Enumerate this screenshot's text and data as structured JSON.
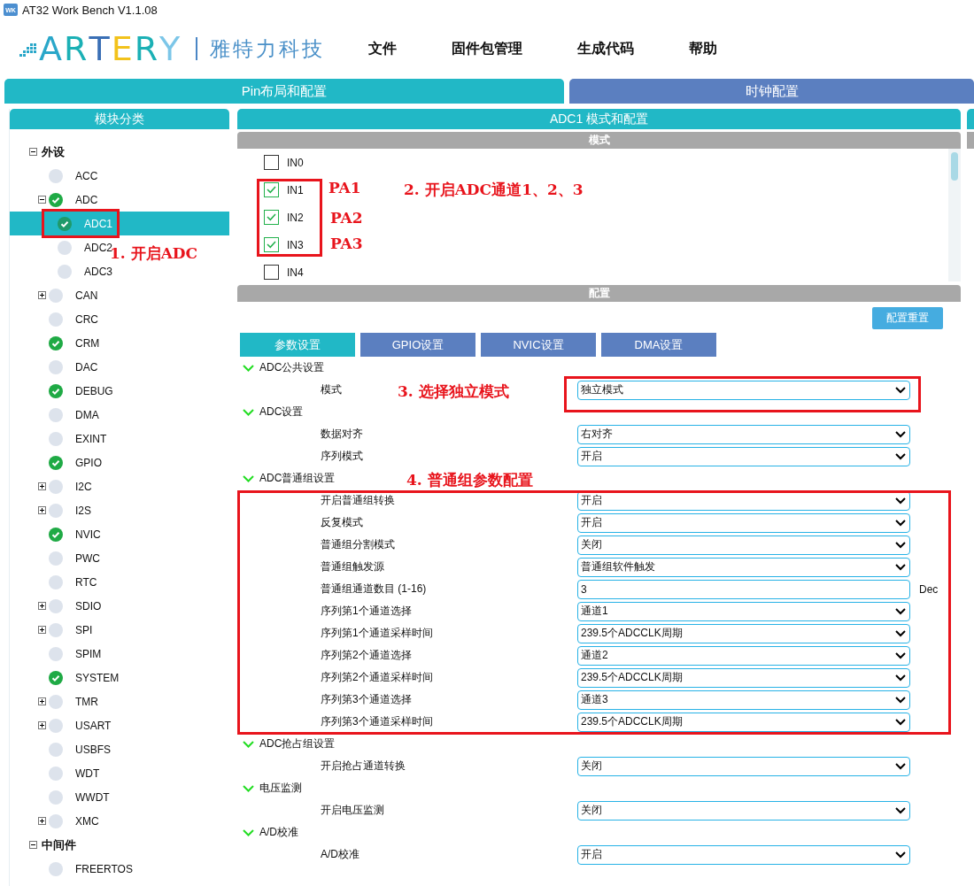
{
  "window": {
    "app_badge": "WK",
    "title": "AT32 Work Bench V1.1.08"
  },
  "header": {
    "logo_letters": [
      "A",
      "R",
      "T",
      "E",
      "R",
      "Y"
    ],
    "company": "雅特力科技",
    "menu": [
      "文件",
      "固件包管理",
      "生成代码",
      "帮助"
    ]
  },
  "top_tabs": [
    {
      "label": "Pin布局和配置",
      "selected": true
    },
    {
      "label": "时钟配置",
      "selected": false
    }
  ],
  "module_panel": {
    "title": "模块分类",
    "tree": [
      {
        "kind": "category",
        "label": "外设",
        "expanded": true,
        "children": [
          {
            "kind": "module",
            "label": "ACC",
            "checked": false,
            "selected": false
          },
          {
            "kind": "module",
            "label": "ADC",
            "checked": true,
            "selected": false,
            "expanded": true,
            "children": [
              {
                "kind": "module",
                "label": "ADC1",
                "checked": true,
                "selected": true
              },
              {
                "kind": "module",
                "label": "ADC2",
                "checked": false,
                "selected": false
              },
              {
                "kind": "module",
                "label": "ADC3",
                "checked": false,
                "selected": false
              }
            ]
          },
          {
            "kind": "module",
            "label": "CAN",
            "checked": false,
            "selected": false,
            "expanded": false
          },
          {
            "kind": "module",
            "label": "CRC",
            "checked": false,
            "selected": false
          },
          {
            "kind": "module",
            "label": "CRM",
            "checked": true,
            "selected": false
          },
          {
            "kind": "module",
            "label": "DAC",
            "checked": false,
            "selected": false
          },
          {
            "kind": "module",
            "label": "DEBUG",
            "checked": true,
            "selected": false
          },
          {
            "kind": "module",
            "label": "DMA",
            "checked": false,
            "selected": false
          },
          {
            "kind": "module",
            "label": "EXINT",
            "checked": false,
            "selected": false
          },
          {
            "kind": "module",
            "label": "GPIO",
            "checked": true,
            "selected": false
          },
          {
            "kind": "module",
            "label": "I2C",
            "checked": false,
            "selected": false,
            "expanded": false
          },
          {
            "kind": "module",
            "label": "I2S",
            "checked": false,
            "selected": false,
            "expanded": false
          },
          {
            "kind": "module",
            "label": "NVIC",
            "checked": true,
            "selected": false
          },
          {
            "kind": "module",
            "label": "PWC",
            "checked": false,
            "selected": false
          },
          {
            "kind": "module",
            "label": "RTC",
            "checked": false,
            "selected": false
          },
          {
            "kind": "module",
            "label": "SDIO",
            "checked": false,
            "selected": false,
            "expanded": false
          },
          {
            "kind": "module",
            "label": "SPI",
            "checked": false,
            "selected": false,
            "expanded": false
          },
          {
            "kind": "module",
            "label": "SPIM",
            "checked": false,
            "selected": false
          },
          {
            "kind": "module",
            "label": "SYSTEM",
            "checked": true,
            "selected": false
          },
          {
            "kind": "module",
            "label": "TMR",
            "checked": false,
            "selected": false,
            "expanded": false
          },
          {
            "kind": "module",
            "label": "USART",
            "checked": false,
            "selected": false,
            "expanded": false
          },
          {
            "kind": "module",
            "label": "USBFS",
            "checked": false,
            "selected": false
          },
          {
            "kind": "module",
            "label": "WDT",
            "checked": false,
            "selected": false
          },
          {
            "kind": "module",
            "label": "WWDT",
            "checked": false,
            "selected": false
          },
          {
            "kind": "module",
            "label": "XMC",
            "checked": false,
            "selected": false,
            "expanded": false
          }
        ]
      },
      {
        "kind": "category",
        "label": "中间件",
        "expanded": true,
        "children": [
          {
            "kind": "module",
            "label": "FREERTOS",
            "checked": false,
            "selected": false
          }
        ]
      }
    ]
  },
  "config_panel": {
    "title": "ADC1 模式和配置",
    "mode_title": "模式",
    "channels": [
      {
        "label": "IN0",
        "checked": false
      },
      {
        "label": "IN1",
        "checked": true
      },
      {
        "label": "IN2",
        "checked": true
      },
      {
        "label": "IN3",
        "checked": true
      },
      {
        "label": "IN4",
        "checked": false
      }
    ],
    "config_title": "配置",
    "reset_button": "配置重置",
    "tabs": [
      {
        "label": "参数设置",
        "selected": true
      },
      {
        "label": "GPIO设置",
        "selected": false
      },
      {
        "label": "NVIC设置",
        "selected": false
      },
      {
        "label": "DMA设置",
        "selected": false
      }
    ],
    "sections": [
      {
        "title": "ADC公共设置",
        "rows": [
          {
            "kind": "select",
            "label": "模式",
            "value": "独立模式"
          }
        ]
      },
      {
        "title": "ADC设置",
        "rows": [
          {
            "kind": "select",
            "label": "数据对齐",
            "value": "右对齐"
          },
          {
            "kind": "select",
            "label": "序列模式",
            "value": "开启"
          }
        ]
      },
      {
        "title": "ADC普通组设置",
        "rows": [
          {
            "kind": "select",
            "label": "开启普通组转换",
            "value": "开启"
          },
          {
            "kind": "select",
            "label": "反复模式",
            "value": "开启"
          },
          {
            "kind": "select",
            "label": "普通组分割模式",
            "value": "关闭"
          },
          {
            "kind": "select",
            "label": "普通组触发源",
            "value": "普通组软件触发"
          },
          {
            "kind": "number",
            "label": "普通组通道数目 (1-16)",
            "value": "3",
            "unit": "Dec"
          },
          {
            "kind": "select",
            "label": "序列第1个通道选择",
            "value": "通道1"
          },
          {
            "kind": "select",
            "label": "序列第1个通道采样时间",
            "value": "239.5个ADCCLK周期"
          },
          {
            "kind": "select",
            "label": "序列第2个通道选择",
            "value": "通道2"
          },
          {
            "kind": "select",
            "label": "序列第2个通道采样时间",
            "value": "239.5个ADCCLK周期"
          },
          {
            "kind": "select",
            "label": "序列第3个通道选择",
            "value": "通道3"
          },
          {
            "kind": "select",
            "label": "序列第3个通道采样时间",
            "value": "239.5个ADCCLK周期"
          }
        ]
      },
      {
        "title": "ADC抢占组设置",
        "rows": [
          {
            "kind": "select",
            "label": "开启抢占通道转换",
            "value": "关闭"
          }
        ]
      },
      {
        "title": "电压监测",
        "rows": [
          {
            "kind": "select",
            "label": "开启电压监测",
            "value": "关闭"
          }
        ]
      },
      {
        "title": "A/D校准",
        "rows": [
          {
            "kind": "select",
            "label": "A/D校准",
            "value": "开启"
          }
        ]
      }
    ]
  },
  "annotations": [
    {
      "text": "1. 开启ADC"
    },
    {
      "text": "PA1"
    },
    {
      "text": "PA2"
    },
    {
      "text": "PA3"
    },
    {
      "text": "2. 开启ADC通道1、2、3"
    },
    {
      "text": "3. 选择独立模式"
    },
    {
      "text": "4. 普通组参数配置"
    }
  ]
}
